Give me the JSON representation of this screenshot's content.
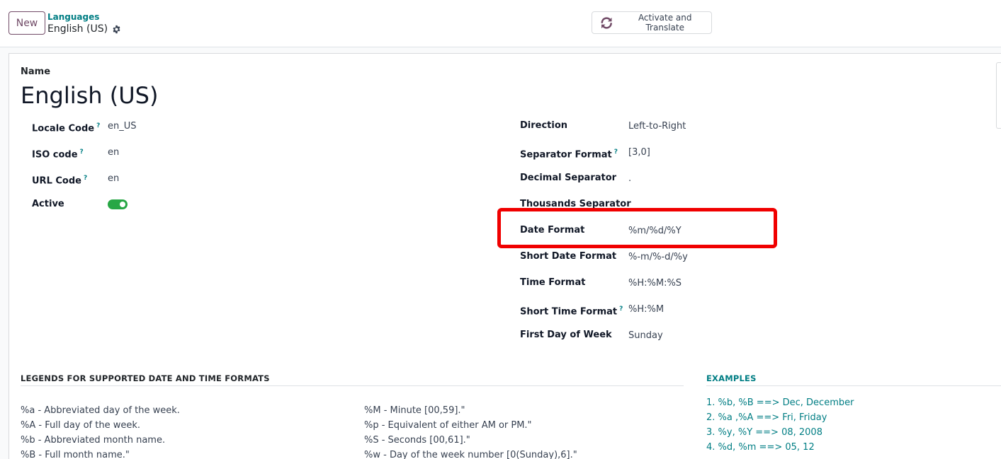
{
  "control_panel": {
    "new_label": "New",
    "breadcrumb_parent": "Languages",
    "breadcrumb_current": "English (US)",
    "action_label": "Activate and Translate"
  },
  "form": {
    "name_label": "Name",
    "name_value": "English (US)",
    "left_fields": [
      {
        "label": "Locale Code",
        "value": "en_US",
        "help": "?"
      },
      {
        "label": "ISO code",
        "value": "en",
        "help": "?"
      },
      {
        "label": "URL Code",
        "value": "en",
        "help": "?"
      },
      {
        "label": "Active"
      }
    ],
    "right_fields": [
      {
        "label": "Direction",
        "value": "Left-to-Right"
      },
      {
        "label": "Separator Format",
        "value": "[3,0]",
        "help": "?"
      },
      {
        "label": "Decimal Separator",
        "value": "."
      },
      {
        "label": "Thousands Separator",
        "value": ""
      },
      {
        "label": "Date Format",
        "value": "%m/%d/%Y"
      },
      {
        "label": "Short Date Format",
        "value": "%-m/%-d/%y"
      },
      {
        "label": "Time Format",
        "value": "%H:%M:%S"
      },
      {
        "label": "Short Time Format",
        "value": "%H:%M",
        "help": "?"
      },
      {
        "label": "First Day of Week",
        "value": "Sunday"
      }
    ],
    "active_toggle": {
      "checked": true,
      "color": "#28a745"
    }
  },
  "legends": {
    "title": "LEGENDS FOR SUPPORTED DATE AND TIME FORMATS",
    "col1": [
      "%a - Abbreviated day of the week.",
      "%A - Full day of the week.",
      "%b - Abbreviated month name.",
      "%B - Full month name.\""
    ],
    "col2": [
      "%M - Minute [00,59].\"",
      "%p - Equivalent of either AM or PM.\"",
      "%S - Seconds [00,61].\"",
      "%w - Day of the week number [0(Sunday),6].\""
    ]
  },
  "examples": {
    "title": "EXAMPLES",
    "items": [
      "1. %b, %B ==> Dec, December",
      "2. %a ,%A ==> Fri, Friday",
      "3. %y, %Y ==> 08, 2008",
      "4. %d, %m ==> 05, 12"
    ]
  },
  "colors": {
    "brand": "#714b67",
    "link": "#017e84",
    "highlight": "#f00000"
  }
}
